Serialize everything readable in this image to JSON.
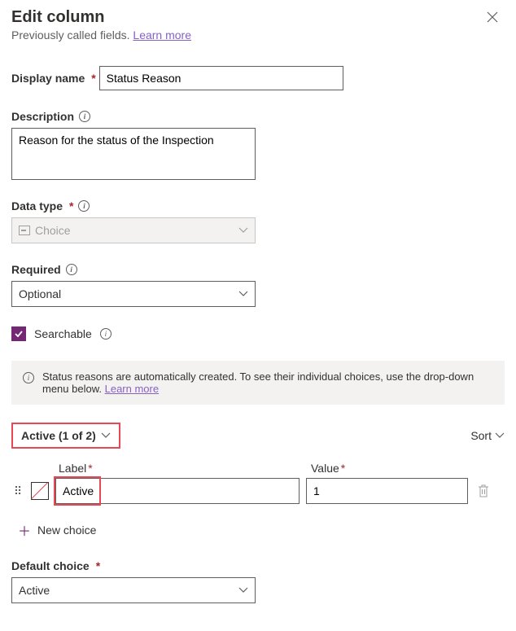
{
  "header": {
    "title": "Edit column",
    "subtitle_prefix": "Previously called fields. ",
    "learn_more": "Learn more"
  },
  "fields": {
    "display_name": {
      "label": "Display name",
      "value": "Status Reason"
    },
    "description": {
      "label": "Description",
      "value": "Reason for the status of the Inspection"
    },
    "data_type": {
      "label": "Data type",
      "value": "Choice"
    },
    "required": {
      "label": "Required",
      "value": "Optional"
    },
    "searchable": {
      "label": "Searchable",
      "checked": true
    },
    "default_choice": {
      "label": "Default choice",
      "value": "Active"
    }
  },
  "info": {
    "text": "Status reasons are automatically created. To see their individual choices, use the drop-down menu below. ",
    "link": "Learn more"
  },
  "state": {
    "selector": "Active (1 of 2)",
    "sort": "Sort"
  },
  "choices": {
    "label_header": "Label",
    "value_header": "Value",
    "rows": [
      {
        "label": "Active",
        "value": "1"
      }
    ],
    "add": "New choice"
  }
}
